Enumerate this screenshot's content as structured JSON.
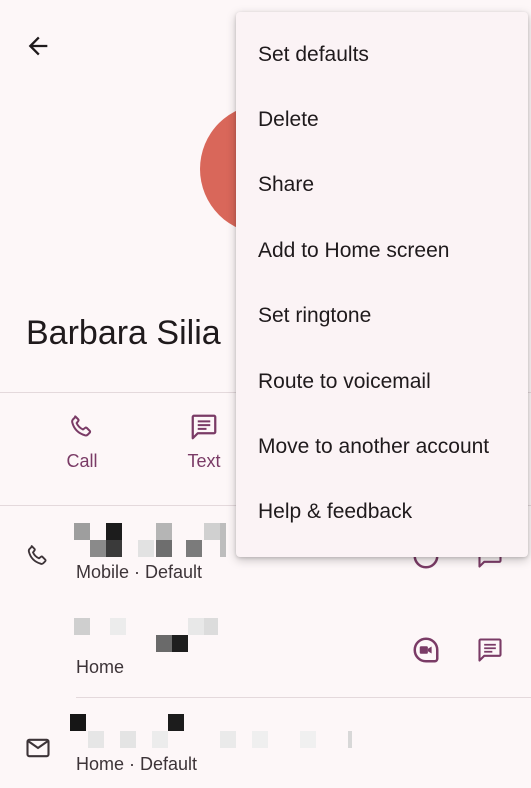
{
  "header": {
    "back_icon": "arrow-left-icon"
  },
  "contact": {
    "name": "Barbara Silia",
    "avatar_color": "#d9675a"
  },
  "actions": [
    {
      "label": "Call",
      "icon": "phone-icon"
    },
    {
      "label": "Text",
      "icon": "message-icon"
    }
  ],
  "details": {
    "phone_mobile_label": "Mobile · Default",
    "phone_home_label": "Home",
    "email_label": "Home · Default"
  },
  "menu": {
    "items": [
      "Set defaults",
      "Delete",
      "Share",
      "Add to Home screen",
      "Set ringtone",
      "Route to voicemail",
      "Move to another account",
      "Help & feedback"
    ]
  },
  "colors": {
    "accent": "#7a3b66",
    "background": "#fdf7f8",
    "menu_bg": "#fbf3f5"
  }
}
